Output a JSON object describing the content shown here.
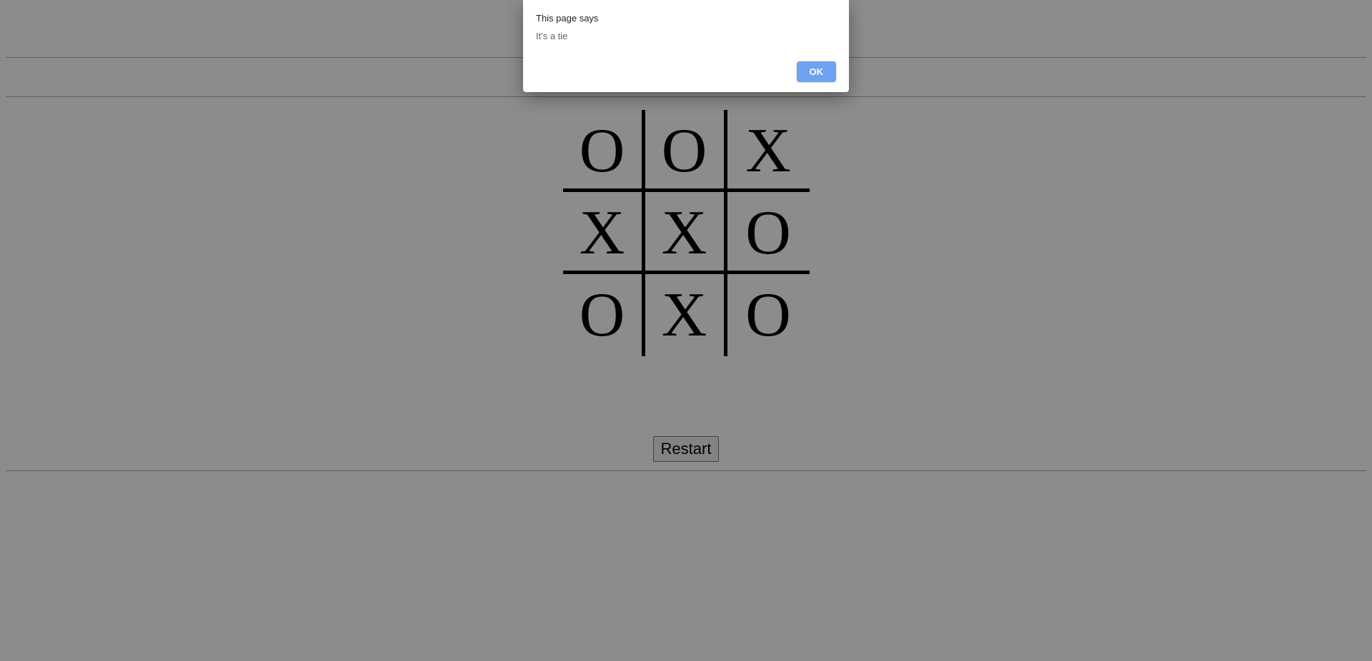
{
  "alert": {
    "title": "This page says",
    "message": "It's a tie",
    "ok_label": "OK"
  },
  "board": {
    "cells": [
      "O",
      "O",
      "X",
      "X",
      "X",
      "O",
      "O",
      "X",
      "O"
    ]
  },
  "controls": {
    "restart_label": "Restart"
  }
}
